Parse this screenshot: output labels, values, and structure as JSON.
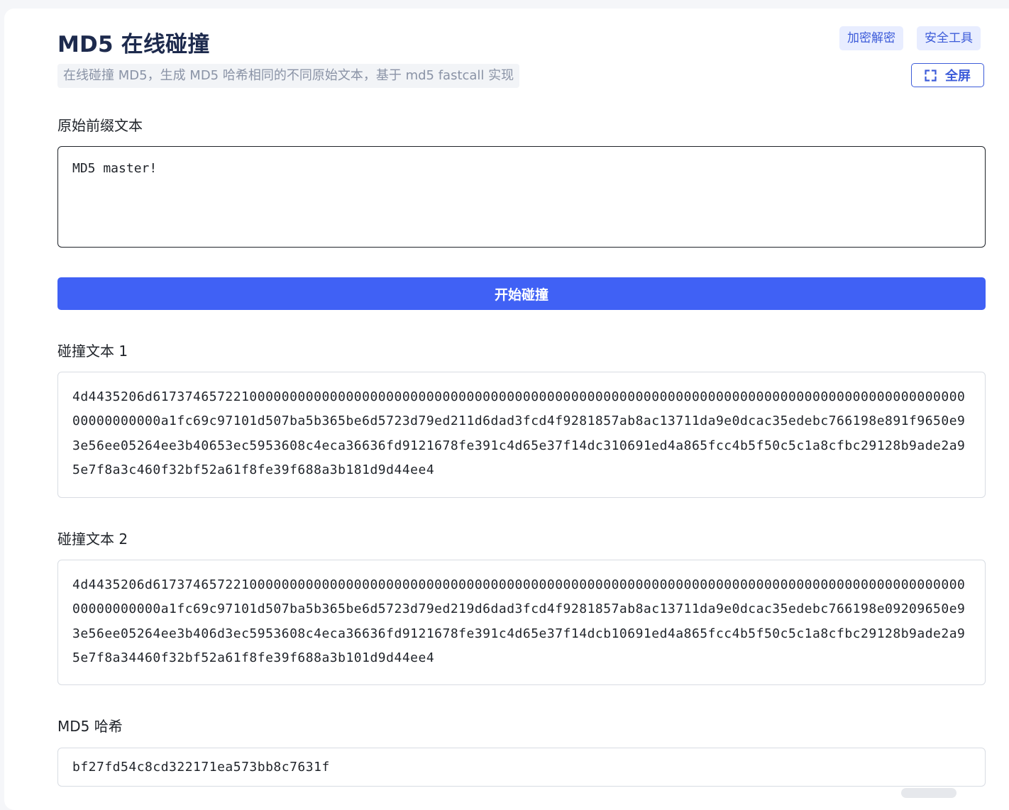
{
  "header": {
    "title": "MD5 在线碰撞",
    "subtitle": "在线碰撞 MD5，生成 MD5 哈希相同的不同原始文本，基于 md5 fastcall 实现",
    "tags": [
      "加密解密",
      "安全工具"
    ],
    "fullscreen_label": "全屏"
  },
  "form": {
    "prefix_label": "原始前缀文本",
    "prefix_value": "MD5 master!",
    "start_button_label": "开始碰撞"
  },
  "results": {
    "collision1_label": "碰撞文本 1",
    "collision1_value": "4d4435206d6173746572210000000000000000000000000000000000000000000000000000000000000000000000000000000000000000000000000000a1fc69c97101d507ba5b365be6d5723d79ed211d6dad3fcd4f9281857ab8ac13711da9e0dcac35edebc766198e891f9650e93e56ee05264ee3b40653ec5953608c4eca36636fd9121678fe391c4d65e37f14dc310691ed4a865fcc4b5f50c5c1a8cfbc29128b9ade2a95e7f8a3c460f32bf52a61f8fe39f688a3b181d9d44ee4",
    "collision2_label": "碰撞文本 2",
    "collision2_value": "4d4435206d6173746572210000000000000000000000000000000000000000000000000000000000000000000000000000000000000000000000000000a1fc69c97101d507ba5b365be6d5723d79ed219d6dad3fcd4f9281857ab8ac13711da9e0dcac35edebc766198e09209650e93e56ee05264ee3b406d3ec5953608c4eca36636fd9121678fe391c4d65e37f14dcb10691ed4a865fcc4b5f50c5c1a8cfbc29128b9ade2a95e7f8a34460f32bf52a61f8fe39f688a3b101d9d44ee4",
    "hash_label": "MD5 哈希",
    "hash_value": "bf27fd54c8cd322171ea573bb8c7631f"
  },
  "icons": {
    "fullscreen": "fullscreen-icon"
  },
  "colors": {
    "primary": "#4061f5",
    "title": "#1d2a4d",
    "tag_bg": "#e8edff",
    "tag_text": "#3d5cd9",
    "border": "#d8dce3"
  }
}
